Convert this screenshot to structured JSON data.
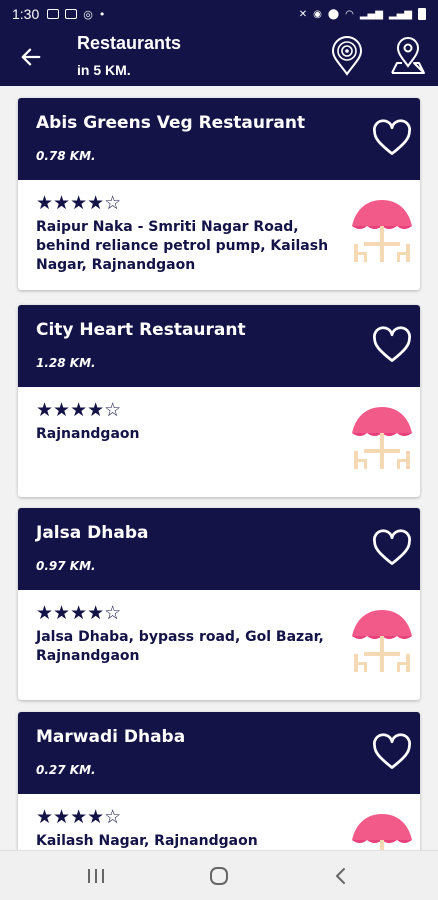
{
  "status_bar": {
    "time": "1:30"
  },
  "app_bar": {
    "title": "Restaurants",
    "subtitle": "in 5 KM."
  },
  "restaurants": [
    {
      "name": "Abis Greens Veg Restaurant",
      "distance": "0.78 KM.",
      "rating_stars": "★★★★☆",
      "address": "Raipur Naka - Smriti Nagar Road, behind reliance petrol pump, Kailash Nagar, Rajnandgaon"
    },
    {
      "name": "City Heart Restaurant",
      "distance": "1.28 KM.",
      "rating_stars": "★★★★☆",
      "address": "Rajnandgaon"
    },
    {
      "name": "Jalsa Dhaba",
      "distance": "0.97 KM.",
      "rating_stars": "★★★★☆",
      "address": "Jalsa Dhaba, bypass road, Gol Bazar, Rajnandgaon"
    },
    {
      "name": "Marwadi Dhaba",
      "distance": "0.27 KM.",
      "rating_stars": "★★★★☆",
      "address": "Kailash Nagar, Rajnandgaon"
    }
  ],
  "icons": {
    "back": "arrow-left-icon",
    "nearby": "location-radar-icon",
    "map": "map-pin-icon",
    "favorite": "heart-outline-icon",
    "restaurant": "restaurant-table-umbrella-icon"
  },
  "colors": {
    "primary": "#131347",
    "umbrella": "#f25a8a",
    "table": "#f5d9b5"
  }
}
